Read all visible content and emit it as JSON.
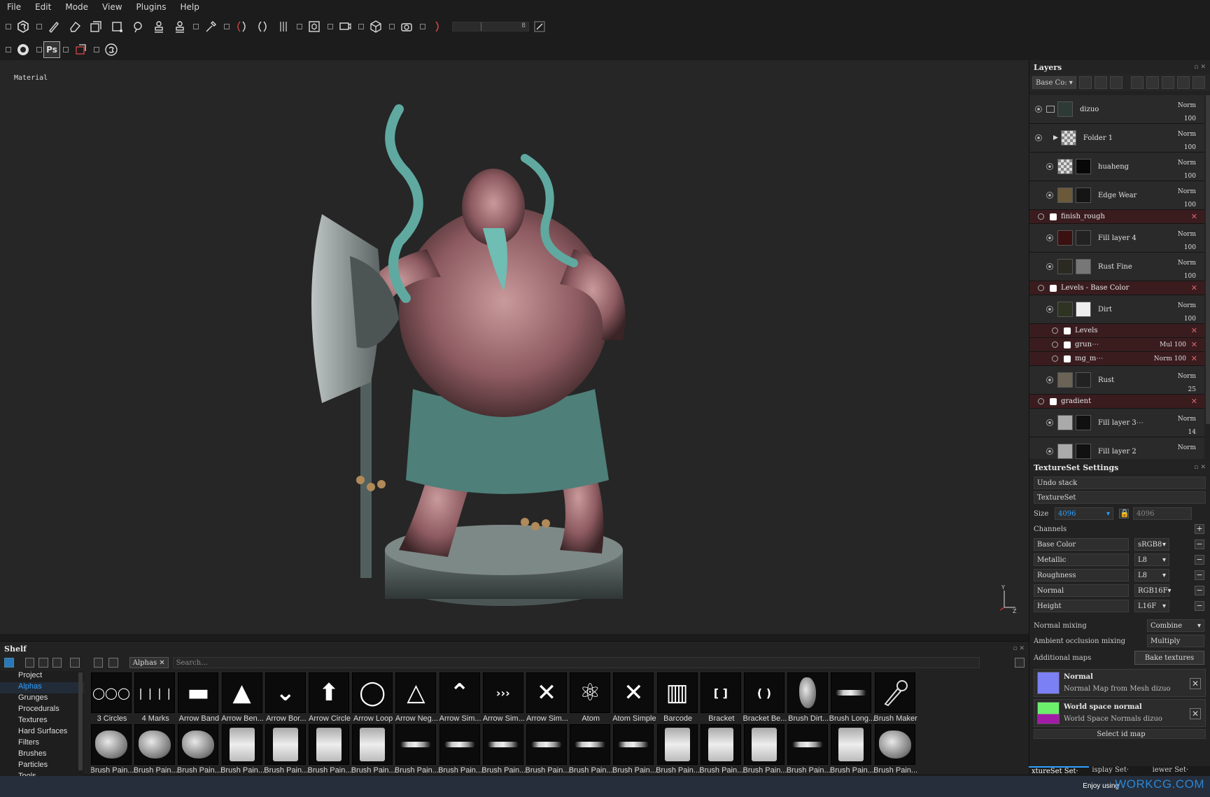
{
  "menu": [
    "File",
    "Edit",
    "Mode",
    "View",
    "Plugins",
    "Help"
  ],
  "toolbar": {
    "brush_size_value": "8"
  },
  "toolbar2": {
    "ps_label": "Ps"
  },
  "viewport": {
    "label": "Material",
    "axis_y": "Y",
    "axis_z": "Z"
  },
  "layers": {
    "title": "Layers",
    "channel_dropdown": "Base Co:",
    "items": [
      {
        "name": "dizuo",
        "blend": "Norm",
        "opacity": "100",
        "thumb": "#2d3a36",
        "mask": ""
      },
      {
        "name": "Folder 1",
        "blend": "Norm",
        "opacity": "100",
        "thumb": "checker",
        "mask": ""
      },
      {
        "name": "huaheng",
        "blend": "Norm",
        "opacity": "100",
        "thumb": "checker",
        "mask": "#080808"
      },
      {
        "name": "Edge Wear",
        "blend": "Norm",
        "opacity": "100",
        "thumb": "#6a5a3a",
        "mask": "#151515"
      },
      {
        "name": "Fill layer 4",
        "blend": "Norm",
        "opacity": "100",
        "thumb": "#3a1010",
        "mask": "#222"
      },
      {
        "name": "Rust Fine",
        "blend": "Norm",
        "opacity": "100",
        "thumb": "#2a2a22",
        "mask": "#777"
      },
      {
        "name": "Dirt",
        "blend": "Norm",
        "opacity": "100",
        "thumb": "#2e3322",
        "mask": "#eee"
      },
      {
        "name": "Rust",
        "blend": "Norm",
        "opacity": "25",
        "thumb": "#6a6356",
        "mask": "#222"
      },
      {
        "name": "Fill layer 3⋯",
        "blend": "Norm",
        "opacity": "14",
        "thumb": "#aaa",
        "mask": "#111"
      },
      {
        "name": "Fill layer 2",
        "blend": "Norm",
        "opacity": "",
        "thumb": "#aaa",
        "mask": "#111"
      }
    ],
    "sublayers": {
      "edge_wear": "finish_rough",
      "rust_fine": "Levels - Base Color",
      "dirt_levels": "Levels",
      "dirt_grunge": {
        "name": "grun⋯",
        "blend": "Mul",
        "opacity": "100"
      },
      "dirt_mg": {
        "name": "mg_m⋯",
        "blend": "Norm",
        "opacity": "100"
      },
      "rust_gradient": "gradient"
    }
  },
  "textureset": {
    "title": "TextureSet Settings",
    "undo_stack": "Undo stack",
    "textureset_label": "TextureSet",
    "size_label": "Size",
    "size_value": "4096",
    "size_value_2": "4096",
    "channels_label": "Channels",
    "channels": [
      {
        "name": "Base Color",
        "format": "sRGB8"
      },
      {
        "name": "Metallic",
        "format": "L8"
      },
      {
        "name": "Roughness",
        "format": "L8"
      },
      {
        "name": "Normal",
        "format": "RGB16F"
      },
      {
        "name": "Height",
        "format": "L16F"
      }
    ],
    "normal_mixing_label": "Normal mixing",
    "normal_mixing_value": "Combine",
    "ao_mixing_label": "Ambient occlusion mixing",
    "ao_mixing_value": "Multiply",
    "additional_maps_label": "Additional maps",
    "bake_button": "Bake textures",
    "maps": [
      {
        "title": "Normal",
        "sub": "Normal Map from Mesh dizuo",
        "color": "#7b80f5"
      },
      {
        "title": "World space normal",
        "sub": "World Space Normals dizuo",
        "color": "#6cf06c"
      }
    ],
    "select_id_map": "Select id map"
  },
  "bottom_tabs": [
    "xtureSet Set·",
    "isplay Set·",
    "iewer Set·"
  ],
  "shelf": {
    "title": "Shelf",
    "filter_chip": "Alphas",
    "search_placeholder": "Search...",
    "categories": [
      "Project",
      "Alphas",
      "Grunges",
      "Procedurals",
      "Textures",
      "Hard Surfaces",
      "Filters",
      "Brushes",
      "Particles",
      "Tools"
    ],
    "active_category": "Alphas",
    "row1": [
      "3 Circles",
      "4 Marks",
      "Arrow Band",
      "Arrow Ben...",
      "Arrow Bor...",
      "Arrow Circle",
      "Arrow Loop",
      "Arrow Neg...",
      "Arrow Sim...",
      "Arrow Sim...",
      "Arrow Sim...",
      "Atom",
      "Atom Simple",
      "Barcode",
      "Bracket",
      "Bracket Be...",
      "Brush Dirt...",
      "Brush Long...",
      "Brush Maker"
    ],
    "row2": [
      "Brush Pain...",
      "Brush Pain...",
      "Brush Pain...",
      "Brush Pain...",
      "Brush Pain...",
      "Brush Pain...",
      "Brush Pain...",
      "Brush Pain...",
      "Brush Pain...",
      "Brush Pain...",
      "Brush Pain...",
      "Brush Pain...",
      "Brush Pain...",
      "Brush Pain...",
      "Brush Pain...",
      "Brush Pain...",
      "Brush Pain...",
      "Brush Pain...",
      "Brush Pain..."
    ]
  },
  "footer": {
    "enjoy": "Enjoy using",
    "brand": "WORKCG.COM"
  }
}
